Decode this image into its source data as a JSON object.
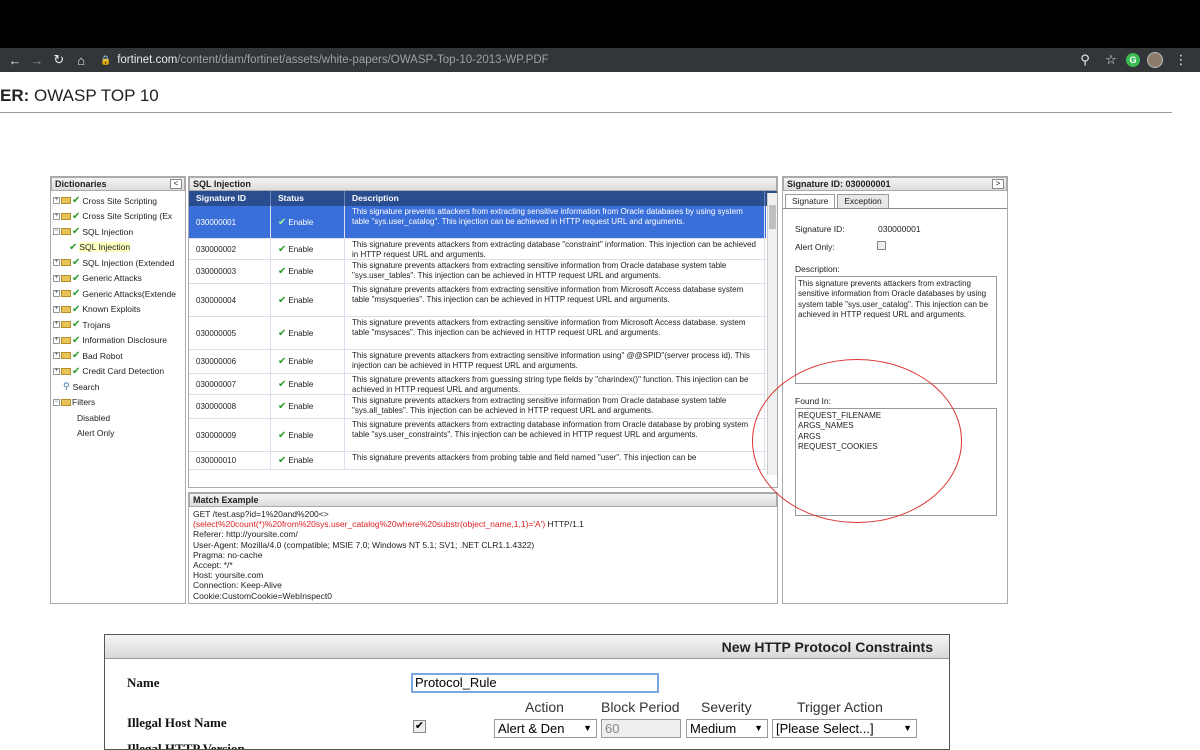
{
  "browser": {
    "url_host": "fortinet.com",
    "url_path": "/content/dam/fortinet/assets/white-papers/OWASP-Top-10-2013-WP.PDF",
    "nav_icons": [
      "back-icon",
      "forward-icon",
      "reload-icon",
      "home-icon"
    ],
    "extension_badge": "G"
  },
  "doc": {
    "title_bold": "ER:",
    "title_rest": " OWASP TOP 10"
  },
  "dictionaries": {
    "title": "Dictionaries",
    "collapse": "<",
    "items": [
      "Cross Site Scripting",
      "Cross Site Scripting (Ex",
      "SQL Injection",
      "SQL Injection",
      "SQL Injection (Extended",
      "Generic Attacks",
      "Generic Attacks(Extende",
      "Known Exploits",
      "Trojans",
      "Information Disclosure",
      "Bad Robot",
      "Credit Card Detection",
      "Search",
      "Filters",
      "Disabled",
      "Alert Only"
    ]
  },
  "sqli": {
    "title": "SQL Injection",
    "headers": [
      "Signature ID",
      "Status",
      "Description"
    ],
    "rows": [
      {
        "id": "030000001",
        "status": "Enable",
        "desc": "This signature prevents attackers from extracting sensitive information from Oracle databases by using system table \"sys.user_catalog\". This injection can be achieved in HTTP request URL and arguments."
      },
      {
        "id": "030000002",
        "status": "Enable",
        "desc": "This signature prevents attackers from extracting database \"constraint\" information. This injection can be achieved in HTTP request URL and arguments."
      },
      {
        "id": "030000003",
        "status": "Enable",
        "desc": "This signature prevents attackers from extracting sensitive information from Oracle database system table \"sys.user_tables\". This injection can be achieved in HTTP request URL and arguments."
      },
      {
        "id": "030000004",
        "status": "Enable",
        "desc": "This signature prevents attackers from extracting sensitive information from Microsoft Access database system table \"msysqueries\". This injection can be achieved in HTTP request URL and arguments."
      },
      {
        "id": "030000005",
        "status": "Enable",
        "desc": "This signature prevents attackers from extracting sensitive information from Microsoft Access database. system table \"msysaces\". This injection can be achieved in HTTP request URL and arguments."
      },
      {
        "id": "030000006",
        "status": "Enable",
        "desc": "This signature prevents attackers from extracting sensitive information using\" @@SPID\"(server process id). This injection can be achieved in HTTP request URL and arguments."
      },
      {
        "id": "030000007",
        "status": "Enable",
        "desc": "This signature prevents attackers from guessing string type fields by \"charindex()\" function. This injection can be achieved in HTTP request URL and arguments."
      },
      {
        "id": "030000008",
        "status": "Enable",
        "desc": "This signature prevents attackers from extracting sensitive information from Oracle database system table \"sys.all_tables\". This injection can be achieved in HTTP request URL and arguments."
      },
      {
        "id": "030000009",
        "status": "Enable",
        "desc": "This signature prevents attackers from extracting database information from Oracle database by probing system table \"sys.user_constraints\". This injection can be achieved in HTTP request URL and arguments."
      },
      {
        "id": "030000010",
        "status": "Enable",
        "desc": "This signature prevents attackers from probing table and field named \"user\". This injection can be"
      }
    ]
  },
  "match": {
    "title": "Match Example",
    "line1": "GET /test.asp?id=1%20and%200<>",
    "line2_red": "(select%20count(*)%20from%20sys.user_catalog%20where%20substr(object_name,1,1)='A')",
    "line2_rest": " HTTP/1.1",
    "lines": [
      "Referer: http://yoursite.com/",
      "User-Agent: Mozilla/4.0 (compatible; MSIE 7.0; Windows NT 5.1; SV1; .NET CLR1.1.4322)",
      "Pragma: no-cache",
      "Accept: */*",
      "Host: yoursite.com",
      "Connection: Keep-Alive",
      "Cookie:CustomCookie=WebInspect0"
    ]
  },
  "signature": {
    "title": "Signature ID: 030000001",
    "collapse": ">",
    "tabs": [
      "Signature",
      "Exception"
    ],
    "id_label": "Signature ID:",
    "id_value": "030000001",
    "alert_label": "Alert Only:",
    "desc_label": "Description:",
    "desc_value": "This signature prevents attackers from extracting sensitive information from Oracle databases by using system table \"sys.user_catalog\". This injection can be achieved in HTTP request URL and arguments.",
    "found_label": "Found In:",
    "found_values": [
      "REQUEST_FILENAME",
      "ARGS_NAMES",
      "ARGS",
      "REQUEST_COOKIES"
    ]
  },
  "form": {
    "title": "New HTTP Protocol Constraints",
    "name_label": "Name",
    "name_value": "Protocol_Rule",
    "col_action": "Action",
    "col_block": "Block Period",
    "col_severity": "Severity",
    "col_trigger": "Trigger Action",
    "row1_label": "Illegal Host Name",
    "row1_checked": "✔",
    "row1_action": "Alert & Den",
    "row1_block": "60",
    "row1_severity": "Medium",
    "row1_trigger": "[Please Select...]",
    "row2_label": "Illegal HTTP Version"
  }
}
